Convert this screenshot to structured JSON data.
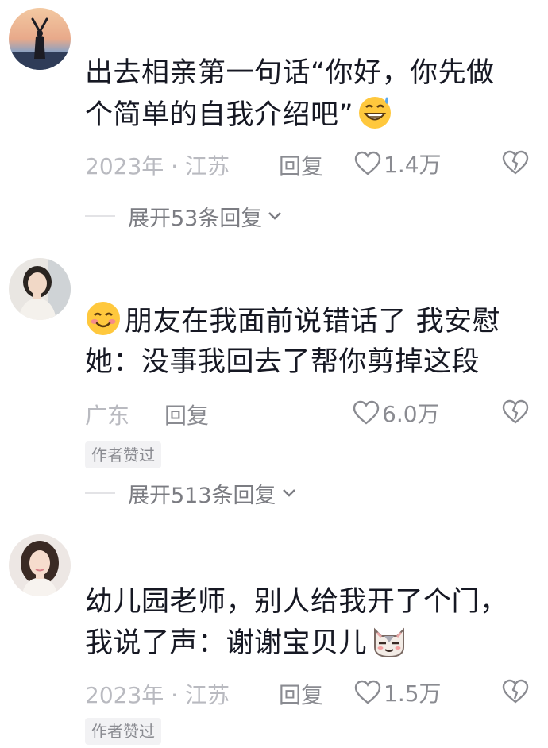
{
  "comments": [
    {
      "lines": [
        "出去相亲第一句话“你好，你先做",
        "个简单的自我介绍吧”"
      ],
      "emoji": "grinning-sweat-emoji",
      "location": "2023年 · 江苏",
      "reply_label": "回复",
      "likes": "1.4万",
      "badge": "",
      "expand_label": "展开53条回复"
    },
    {
      "lines": [
        "朋友在我面前说错话了 我安慰",
        "她：没事我回去了帮你剪掉这段"
      ],
      "emoji": "smiling-blush-emoji",
      "location": "广东",
      "reply_label": "回复",
      "likes": "6.0万",
      "badge": "作者赞过",
      "expand_label": "展开513条回复"
    },
    {
      "lines": [
        "幼儿园老师，别人给我开了个门，",
        "我说了声：谢谢宝贝儿"
      ],
      "emoji": "smug-cat-emoji",
      "location": "2023年 · 江苏",
      "reply_label": "回复",
      "likes": "1.5万",
      "badge": "作者赞过",
      "expand_label": ""
    }
  ],
  "colors": {
    "text": "#161823",
    "meta": "#b9bac0",
    "action": "#8a8b91",
    "badge_bg": "#f2f2f4"
  }
}
